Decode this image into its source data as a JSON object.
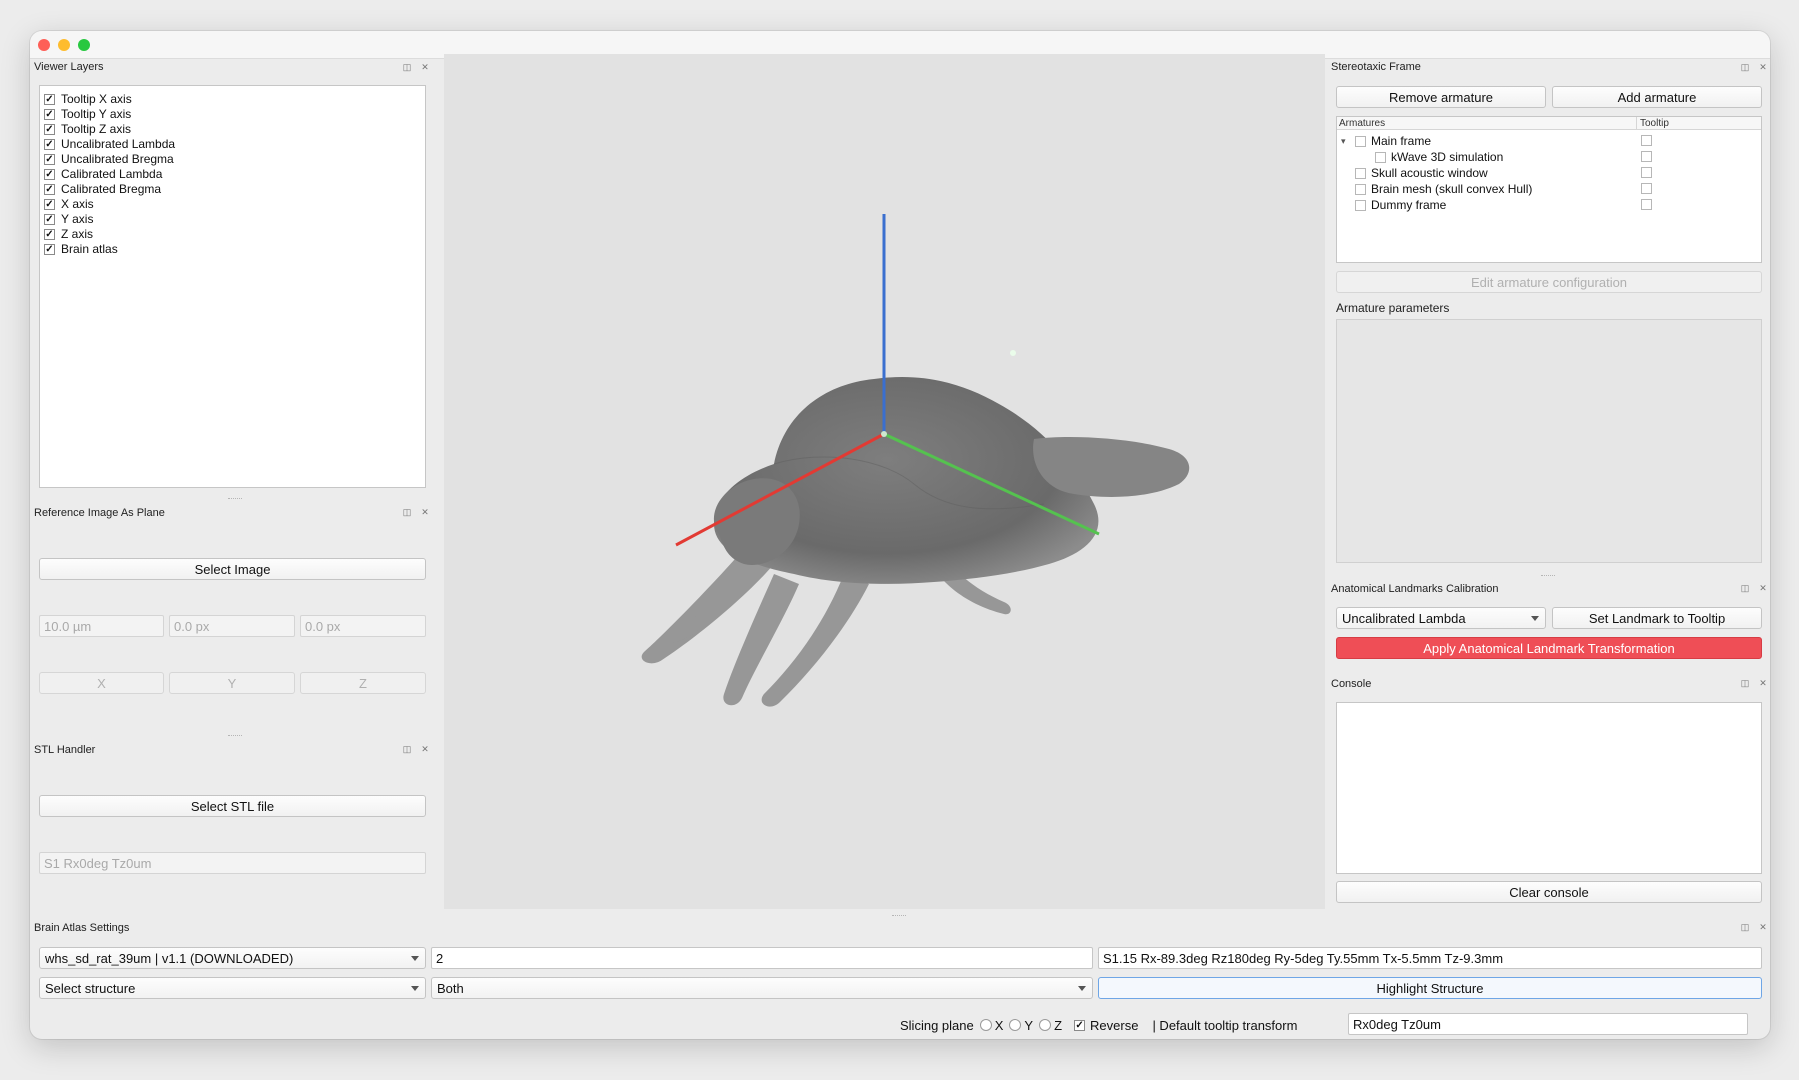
{
  "viewer_layers": {
    "title": "Viewer Layers",
    "items": [
      {
        "label": "Tooltip X axis",
        "checked": true
      },
      {
        "label": "Tooltip Y axis",
        "checked": true
      },
      {
        "label": "Tooltip Z axis",
        "checked": true
      },
      {
        "label": "Uncalibrated Lambda",
        "checked": true
      },
      {
        "label": "Uncalibrated Bregma",
        "checked": true
      },
      {
        "label": "Calibrated Lambda",
        "checked": true
      },
      {
        "label": "Calibrated Bregma",
        "checked": true
      },
      {
        "label": "X axis",
        "checked": true
      },
      {
        "label": "Y axis",
        "checked": true
      },
      {
        "label": "Z axis",
        "checked": true
      },
      {
        "label": "Brain atlas",
        "checked": true
      }
    ]
  },
  "reference_image": {
    "title": "Reference Image As Plane",
    "select_label": "Select Image",
    "field_scale": "10.0 µm",
    "field_px1": "0.0 px",
    "field_px2": "0.0 px",
    "btn_x": "X",
    "btn_y": "Y",
    "btn_z": "Z"
  },
  "stl_handler": {
    "title": "STL Handler",
    "select_label": "Select STL file",
    "transform_placeholder": "S1 Rx0deg Tz0um"
  },
  "stereotaxic": {
    "title": "Stereotaxic Frame",
    "remove_label": "Remove armature",
    "add_label": "Add armature",
    "col_armatures": "Armatures",
    "col_tooltip": "Tooltip",
    "tree": [
      {
        "label": "Main frame",
        "level": 0,
        "expander": true
      },
      {
        "label": "kWave 3D simulation",
        "level": 1,
        "expander": false
      },
      {
        "label": "Skull acoustic window",
        "level": 0,
        "expander": false
      },
      {
        "label": "Brain mesh (skull convex Hull)",
        "level": 0,
        "expander": false
      },
      {
        "label": "Dummy frame",
        "level": 0,
        "expander": false
      }
    ],
    "edit_label": "Edit armature configuration",
    "params_label": "Armature parameters"
  },
  "landmarks": {
    "title": "Anatomical Landmarks Calibration",
    "selected": "Uncalibrated Lambda",
    "set_label": "Set Landmark to Tooltip",
    "apply_label": "Apply Anatomical Landmark Transformation"
  },
  "console": {
    "title": "Console",
    "clear_label": "Clear console"
  },
  "atlas": {
    "title": "Brain Atlas Settings",
    "atlas_selected": "whs_sd_rat_39um | v1.1 (DOWNLOADED)",
    "field_value": "2",
    "transform_value": "S1.15 Rx-89.3deg Rz180deg Ry-5deg Ty.55mm Tx-5.5mm Tz-9.3mm",
    "structure_selected": "Select structure",
    "hemisphere_selected": "Both",
    "highlight_label": "Highlight Structure"
  },
  "bottom": {
    "slicing_label": "Slicing plane",
    "radio_x": "X",
    "radio_y": "Y",
    "radio_z": "Z",
    "reverse_label": "Reverse",
    "reverse_checked": true,
    "default_tooltip_label": "| Default tooltip transform",
    "default_tooltip_value": "Rx0deg Tz0um"
  },
  "colors": {
    "x_axis": "#e23a33",
    "y_axis": "#55c24f",
    "z_axis": "#3a6fcf",
    "apply_button": "#ef4e56"
  }
}
